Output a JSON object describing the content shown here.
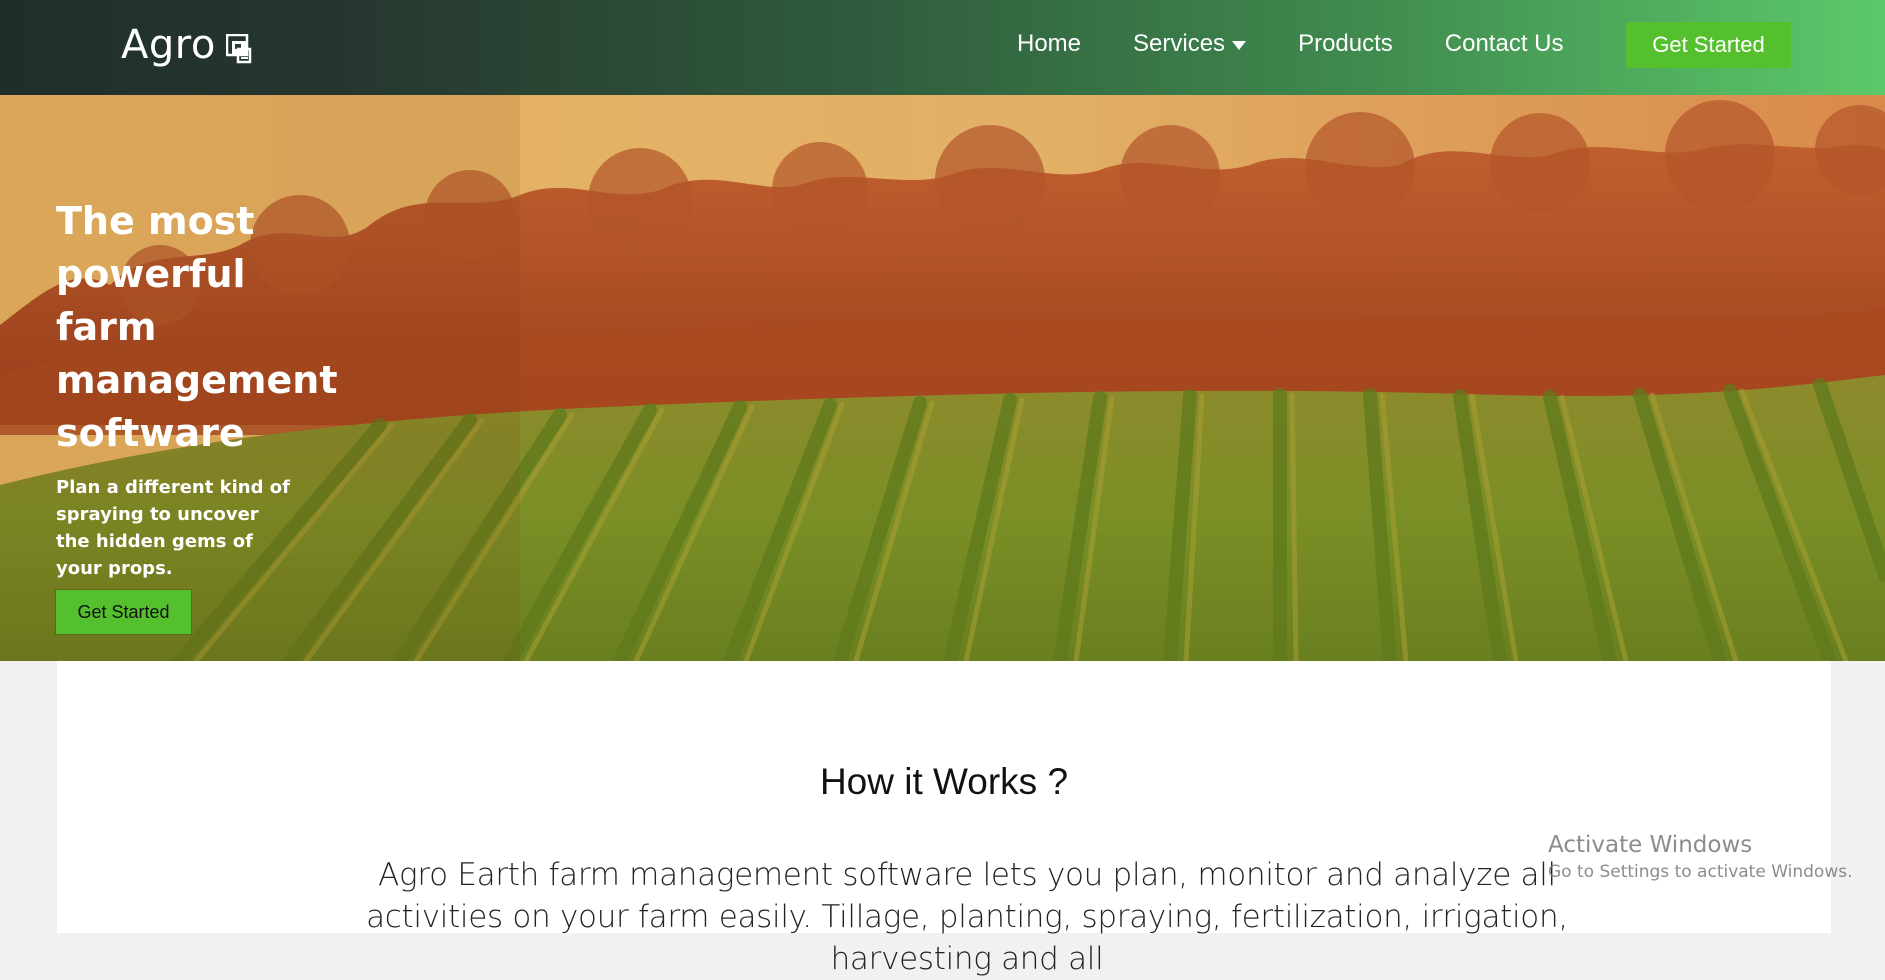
{
  "navbar": {
    "brand": "Agro",
    "brand_icon": "stacked-squares-icon",
    "links": [
      {
        "label": "Home"
      },
      {
        "label": "Services",
        "icon": "caret-down-icon"
      },
      {
        "label": "Products"
      },
      {
        "label": "Contact Us"
      }
    ],
    "cta_label": "Get Started",
    "cta_color": "#55c02e"
  },
  "hero": {
    "title": "The most powerful farm management software",
    "subtitle": "Plan a different kind of spraying to uncover the hidden gems of your props.",
    "cta_label": "Get Started"
  },
  "how_it_works": {
    "title": "How it Works ?",
    "body": "Agro Earth farm management software lets you plan, monitor and analyze all activities on your farm easily. Tillage, planting, spraying, fertilization, irrigation, harvesting and all"
  },
  "watermark": {
    "title": "Activate Windows",
    "subtitle": "Go to Settings to activate Windows."
  }
}
